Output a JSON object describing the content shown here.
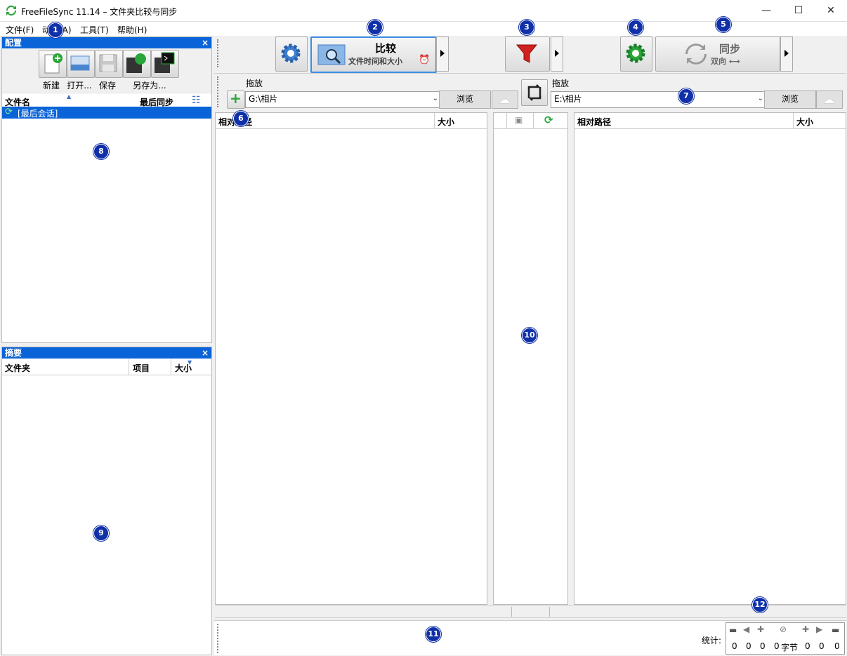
{
  "window": {
    "title": "FreeFileSync 11.14 – 文件夹比较与同步",
    "minimize": "—",
    "maximize": "☐",
    "close": "✕"
  },
  "menu": [
    "文件(F)",
    "动作(A)",
    "工具(T)",
    "帮助(H)"
  ],
  "config_panel": {
    "title": "配置",
    "close": "×",
    "buttons": [
      "新建",
      "打开...",
      "保存",
      "另存为..."
    ],
    "columns": {
      "name": "文件名",
      "last_sync": "最后同步"
    },
    "items": [
      "[最后会话]"
    ]
  },
  "summary_panel": {
    "title": "摘要",
    "close": "×",
    "columns": {
      "folder": "文件夹",
      "items": "项目",
      "size": "大小"
    }
  },
  "toolbar": {
    "compare_label": "比较",
    "compare_sub": "文件时间和大小",
    "sync_label": "同步",
    "sync_sub": "双向 ⟷"
  },
  "folders": {
    "left_label": "拖放",
    "left_path": "G:\\相片",
    "right_label": "拖放",
    "right_path": "E:\\相片",
    "browse": "浏览"
  },
  "grid": {
    "left_rel_path": "相对路径",
    "left_size": "大小",
    "right_rel_path": "相对路径",
    "right_size": "大小"
  },
  "stats": {
    "label": "统计:",
    "values": [
      "0",
      "0",
      "0",
      "0",
      "字节",
      "0",
      "0",
      "0"
    ]
  },
  "markers": [
    "1",
    "2",
    "3",
    "4",
    "5",
    "6",
    "7",
    "8",
    "9",
    "10",
    "11",
    "12"
  ]
}
